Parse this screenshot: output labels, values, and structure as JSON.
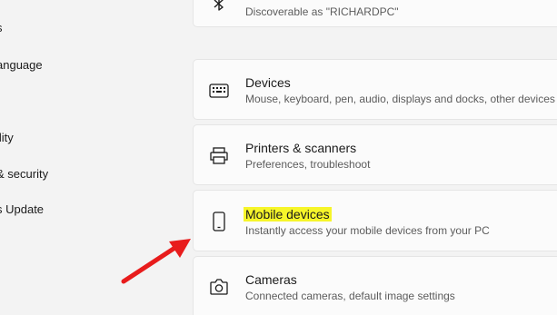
{
  "nav": {
    "items": [
      {
        "label": "s"
      },
      {
        "label": "anguage"
      },
      {
        "label": "ility"
      },
      {
        "label": "& security"
      },
      {
        "label": "s Update"
      }
    ]
  },
  "bluetooth": {
    "description": "Discoverable as \"RICHARDPC\""
  },
  "devices": {
    "title": "Devices",
    "description": "Mouse, keyboard, pen, audio, displays and docks, other devices",
    "icon": "keyboard-device-icon"
  },
  "printers": {
    "title": "Printers & scanners",
    "description": "Preferences, troubleshoot",
    "icon": "printer-icon"
  },
  "mobile": {
    "title": "Mobile devices",
    "description": "Instantly access your mobile devices from your PC",
    "icon": "phone-icon",
    "highlight_color": "#f6f52a"
  },
  "cameras": {
    "title": "Cameras",
    "description": "Connected cameras, default image settings",
    "icon": "camera-icon"
  },
  "annotation": {
    "arrow_color": "#e81c1c",
    "icon": "red-arrow-icon"
  }
}
